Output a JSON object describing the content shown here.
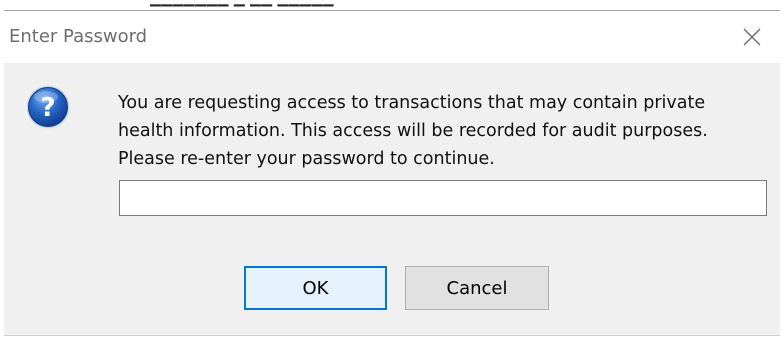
{
  "window": {
    "title": "Enter Password",
    "close_icon": "close-icon"
  },
  "message": {
    "icon": "question-icon",
    "lines": [
      "You are requesting access to transactions that may contain private",
      "health information. This access will be recorded for audit purposes.",
      "Please re-enter your password to continue."
    ]
  },
  "password": {
    "value": "",
    "placeholder": ""
  },
  "buttons": {
    "ok_label": "OK",
    "cancel_label": "Cancel"
  },
  "colors": {
    "dialog_background": "#f0f0f0",
    "titlebar_background": "#ffffff",
    "title_text": "#6d6d6d",
    "default_button_border": "#0078d7",
    "default_button_fill": "#e5f1fb",
    "button_fill": "#e1e1e1",
    "icon_blue": "#1f5fbf"
  }
}
